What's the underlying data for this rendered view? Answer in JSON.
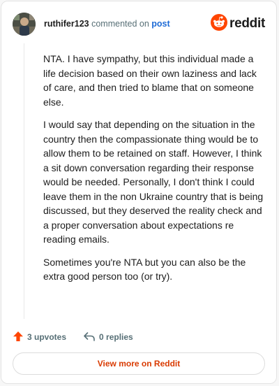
{
  "header": {
    "username": "ruthifer123",
    "action_text": "commented on",
    "post_link": "post",
    "brand_word": "reddit"
  },
  "comment": {
    "paragraphs": [
      "NTA. I have sympathy, but this individual made a life decision based on their own laziness and lack of care, and then tried to blame that on someone else.",
      "I would say that depending on the situation in the country then the compassionate thing would be to allow them to be retained on staff. However, I think a sit down conversation regarding their response would be needed. Personally, I don't think I could leave them in the non Ukraine country that is being discussed, but they deserved the reality check and a proper conversation about expectations re reading emails.",
      "Sometimes you're NTA but you can also be the extra good person too (or try)."
    ]
  },
  "actions": {
    "upvotes": "3 upvotes",
    "replies": "0 replies"
  },
  "view_more_label": "View more on Reddit",
  "colors": {
    "brand": "#ff4500",
    "link": "#1e6bd6",
    "cta": "#d93a00",
    "muted": "#576f76"
  },
  "icons": [
    "avatar",
    "reddit-logo-icon",
    "upvote-icon",
    "reply-icon"
  ]
}
